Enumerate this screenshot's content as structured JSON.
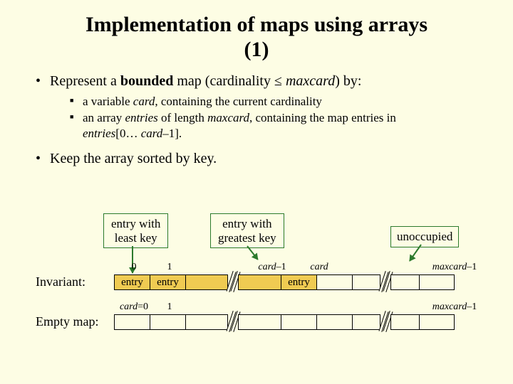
{
  "title_l1": "Implementation of maps using arrays",
  "title_l2": "(1)",
  "b1_pre": "Represent a ",
  "b1_bold": "bounded",
  "b1_mid": " map (cardinality ≤ ",
  "b1_mc": "maxcard",
  "b1_post": ") by:",
  "s1_a": "a variable ",
  "s1_card": "card",
  "s1_b": ", containing the current cardinality",
  "s2_a": "an array ",
  "s2_entries": "entries",
  "s2_b": " of length ",
  "s2_mc": "maxcard",
  "s2_c": ", containing the map entries in ",
  "s2_d": "entries",
  "s2_e": "[0… ",
  "s2_f": "card",
  "s2_g": "–1].",
  "b2": "Keep the array sorted by key.",
  "call_least_l1": "entry with",
  "call_least_l2": "least key",
  "call_great_l1": "entry with",
  "call_great_l2": "greatest key",
  "call_unocc": "unoccupied",
  "lbl_invariant": "Invariant:",
  "lbl_empty": "Empty map:",
  "idx0": "0",
  "idx1": "1",
  "idx_cardm1_a": "card",
  "idx_cardm1_b": "–1",
  "idx_card": "card",
  "idx_maxm1_a": "maxcard",
  "idx_maxm1_b": "–1",
  "cell_entry": "entry",
  "idx2_card0_a": "card",
  "idx2_card0_b": "=0",
  "idx2_1": "1",
  "idx2_maxm1_a": "maxcard",
  "idx2_maxm1_b": "–1"
}
